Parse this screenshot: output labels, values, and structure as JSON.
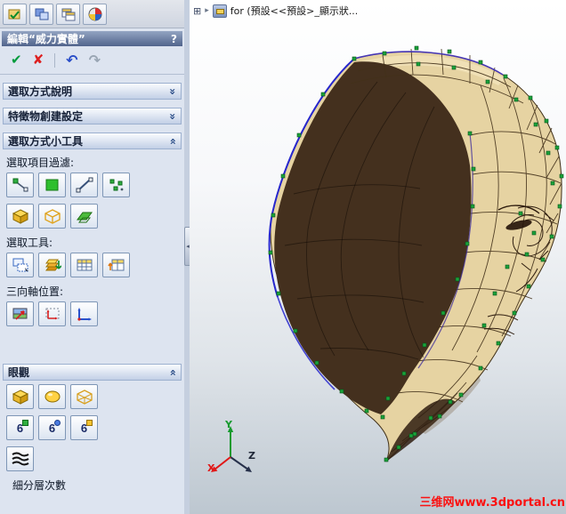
{
  "icons": {
    "chevron_collapsed": "»",
    "chevron_expanded": "»",
    "ok": "✔",
    "cancel": "✘",
    "undo": "↶",
    "redo": "↷",
    "expand_box": "⊞",
    "flyout_arrow": "▸"
  },
  "panel": {
    "title": "編輯“威力實體”",
    "help": "?",
    "sections": {
      "selection_help": "選取方式說明",
      "feature_settings": "特徵物創建設定",
      "selection_tools": "選取方式小工具",
      "display": "眼觀"
    },
    "labels": {
      "filter": "選取項目過濾:",
      "tools": "選取工具:",
      "triad": "三向軸位置:",
      "subdiv": "細分層次數"
    },
    "six": "6"
  },
  "viewport": {
    "tree_text": "for (預設<<預設>_顯示狀...",
    "axes": {
      "x": "X",
      "y": "Y",
      "z": "Z"
    },
    "watermark": "三维网www.3dportal.cn"
  }
}
